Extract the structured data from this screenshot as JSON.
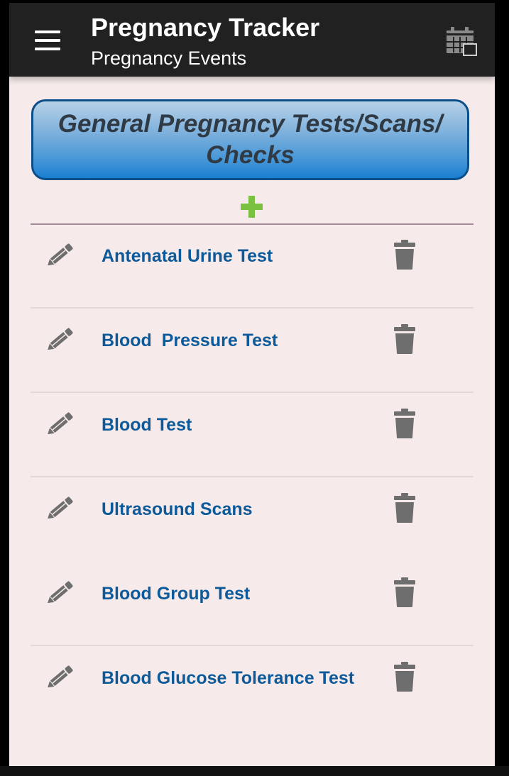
{
  "app": {
    "title": "Pregnancy Tracker",
    "subtitle": "Pregnancy Events",
    "menu_icon": "hamburger-menu-icon",
    "calendar_icon": "calendar-icon"
  },
  "section": {
    "title": "General Pregnancy Tests/Scans/ Checks",
    "add_icon": "plus-icon"
  },
  "colors": {
    "appbar": "#212121",
    "background": "#f6eaea",
    "item_text": "#0d5a9a",
    "add_icon": "#7ac142",
    "icon_gray": "#6e6e6e"
  },
  "events": [
    {
      "label": "Antenatal Urine Test"
    },
    {
      "label": "Blood  Pressure Test"
    },
    {
      "label": "Blood Test"
    },
    {
      "label": "Ultrasound Scans"
    },
    {
      "label": "Blood Group Test"
    },
    {
      "label": "Blood Glucose Tolerance Test"
    }
  ]
}
